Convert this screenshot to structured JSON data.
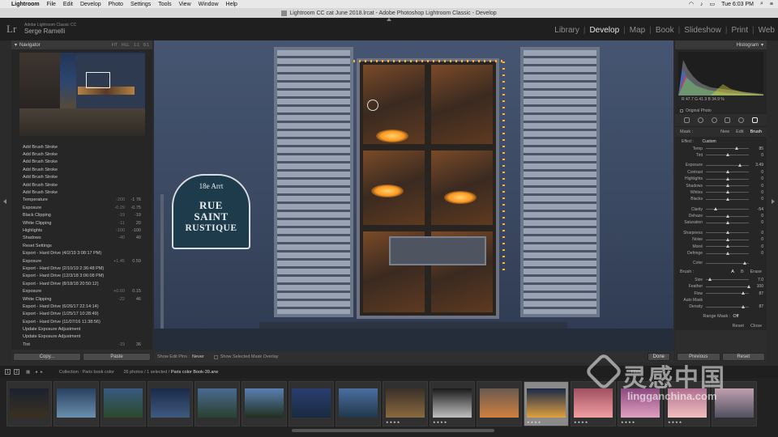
{
  "menubar": {
    "items": [
      "Lightroom",
      "File",
      "Edit",
      "Develop",
      "Photo",
      "Settings",
      "Tools",
      "View",
      "Window",
      "Help"
    ],
    "clock": "Tue 6:03 PM"
  },
  "titlebar": {
    "title": "Lightroom CC cat June 2018.lrcat - Adobe Photoshop Lightroom Classic - Develop"
  },
  "identity": {
    "logo": "Lr",
    "product": "Adobe Lightroom Classic CC",
    "user": "Serge Ramelli"
  },
  "modules": [
    "Library",
    "Develop",
    "Map",
    "Book",
    "Slideshow",
    "Print",
    "Web"
  ],
  "navigator": {
    "title": "Navigator",
    "zoom": [
      "FIT",
      "FILL",
      "1:1",
      "8:1"
    ]
  },
  "history": [
    {
      "label": "Add Brush Stroke",
      "from": "",
      "to": ""
    },
    {
      "label": "Add Brush Stroke",
      "from": "",
      "to": ""
    },
    {
      "label": "Add Brush Stroke",
      "from": "",
      "to": ""
    },
    {
      "label": "Add Brush Stroke",
      "from": "",
      "to": ""
    },
    {
      "label": "Add Brush Stroke",
      "from": "",
      "to": ""
    },
    {
      "label": "Add Brush Stroke",
      "from": "",
      "to": ""
    },
    {
      "label": "Add Brush Stroke",
      "from": "",
      "to": ""
    },
    {
      "label": "Temperature",
      "from": "-200",
      "to": "-1 76"
    },
    {
      "label": "Exposure",
      "from": "-0.29",
      "to": "-0.75"
    },
    {
      "label": "Black Clipping",
      "from": "-19",
      "to": "-19"
    },
    {
      "label": "White Clipping",
      "from": "-11",
      "to": "20"
    },
    {
      "label": "Highlights",
      "from": "-100",
      "to": "-100"
    },
    {
      "label": "Shadows",
      "from": "-40",
      "to": "40"
    },
    {
      "label": "Reset Settings",
      "from": "",
      "to": ""
    },
    {
      "label": "Export - Hard Drive (4/2/19 3:08:17 PM)",
      "from": "",
      "to": ""
    },
    {
      "label": "Exposure",
      "from": "+1.45",
      "to": "0.59"
    },
    {
      "label": "Export - Hard Drive (2/10/19 2:36:48 PM)",
      "from": "",
      "to": ""
    },
    {
      "label": "Export - Hard Drive (12/3/18 3:06:08 PM)",
      "from": "",
      "to": ""
    },
    {
      "label": "Export - Hard Drive (8/18/18 20:50:12)",
      "from": "",
      "to": ""
    },
    {
      "label": "Exposure",
      "from": "+0.60",
      "to": "0.15"
    },
    {
      "label": "White Clipping",
      "from": "-22",
      "to": "46"
    },
    {
      "label": "Export - Hard Drive (6/26/17 22:14:14)",
      "from": "",
      "to": ""
    },
    {
      "label": "Export - Hard Drive (1/25/17 10:28:49)",
      "from": "",
      "to": ""
    },
    {
      "label": "Export - Hard Drive (11/07/16 11:38:56)",
      "from": "",
      "to": ""
    },
    {
      "label": "Update Exposure Adjustment",
      "from": "",
      "to": ""
    },
    {
      "label": "Update Exposure Adjustment",
      "from": "",
      "to": ""
    },
    {
      "label": "Tint",
      "from": "-19",
      "to": "36"
    }
  ],
  "left_buttons": {
    "copy": "Copy...",
    "paste": "Paste"
  },
  "sign": {
    "arr": "18e Arrt",
    "line1": "RUE",
    "line2": "SAINT",
    "line3": "RUSTIQUE"
  },
  "toolbar": {
    "show_edit_pins_label": "Show Edit Pins :",
    "show_edit_pins_value": "Never",
    "overlay_label": "Show Selected Mask Overlay",
    "done": "Done"
  },
  "right_panel": {
    "histogram_title": "Histogram",
    "readout": "R 47.7  G 41.9  B 34.9 %",
    "original_photo": "Original Photo",
    "mask_label": "Mask :",
    "mask_modes": [
      "New",
      "Edit",
      "Brush"
    ],
    "effect_label": "Effect :",
    "effect_value": "Custom",
    "sliders": [
      {
        "label": "Temp",
        "pos": 0.72,
        "value": "85"
      },
      {
        "label": "Tint",
        "pos": 0.5,
        "value": "0"
      },
      {
        "gap": true
      },
      {
        "label": "Exposure",
        "pos": 0.8,
        "value": "3.49"
      },
      {
        "label": "Contrast",
        "pos": 0.5,
        "value": "0"
      },
      {
        "label": "Highlights",
        "pos": 0.5,
        "value": "0"
      },
      {
        "label": "Shadows",
        "pos": 0.5,
        "value": "0"
      },
      {
        "label": "Whites",
        "pos": 0.5,
        "value": "0"
      },
      {
        "label": "Blacks",
        "pos": 0.5,
        "value": "0"
      },
      {
        "gap": true
      },
      {
        "label": "Clarity",
        "pos": 0.22,
        "value": "-54"
      },
      {
        "label": "Dehaze",
        "pos": 0.5,
        "value": "0"
      },
      {
        "label": "Saturation",
        "pos": 0.5,
        "value": "0"
      },
      {
        "gap": true
      },
      {
        "label": "Sharpness",
        "pos": 0.5,
        "value": "0"
      },
      {
        "label": "Noise",
        "pos": 0.5,
        "value": "0"
      },
      {
        "label": "Moiré",
        "pos": 0.5,
        "value": "0"
      },
      {
        "label": "Defringe",
        "pos": 0.5,
        "value": "0"
      },
      {
        "gap": true
      },
      {
        "label": "Color",
        "pos": 0.9,
        "value": ""
      }
    ],
    "brush_label": "Brush :",
    "brush_modes": [
      "A",
      "B",
      "Erase"
    ],
    "brush_sliders": [
      {
        "label": "Size",
        "pos": 0.1,
        "value": "7.0"
      },
      {
        "label": "Feather",
        "pos": 1.0,
        "value": "100"
      },
      {
        "label": "Flow",
        "pos": 0.87,
        "value": "87"
      },
      {
        "label": "Auto Mask",
        "pos": -1,
        "value": ""
      },
      {
        "label": "Density",
        "pos": 0.87,
        "value": "87"
      }
    ],
    "range_mask_label": "Range Mask :",
    "range_mask_value": "Off",
    "reset": "Reset",
    "close": "Close",
    "previous": "Previous",
    "reset_button": "Reset"
  },
  "film_bar": {
    "view1": "1",
    "view2": "2",
    "collection": "Collection : Paris book color",
    "count": "26 photos / 1 selected /",
    "filename": "Paris color Book-39.arw",
    "filter_label": "Filter :"
  },
  "thumbs": [
    {
      "colors": [
        "#1c2230",
        "#3a3020"
      ],
      "stars": ""
    },
    {
      "colors": [
        "#2a4060",
        "#6a90b0"
      ],
      "stars": ""
    },
    {
      "colors": [
        "#3a5a80",
        "#2a4a2a"
      ],
      "stars": ""
    },
    {
      "colors": [
        "#1a2a48",
        "#405a80"
      ],
      "stars": ""
    },
    {
      "colors": [
        "#4a6a90",
        "#2a4030"
      ],
      "stars": ""
    },
    {
      "colors": [
        "#5a80b0",
        "#203020"
      ],
      "stars": ""
    },
    {
      "colors": [
        "#2a3e70",
        "#1a2a40"
      ],
      "stars": ""
    },
    {
      "colors": [
        "#4a6ea0",
        "#20384a"
      ],
      "stars": ""
    },
    {
      "colors": [
        "#3a3028",
        "#8a6a40"
      ],
      "stars": "★★★★"
    },
    {
      "colors": [
        "#1a1a1a",
        "#c0c0c0"
      ],
      "stars": "★★★★"
    },
    {
      "colors": [
        "#6a5a50",
        "#d08040"
      ],
      "stars": ""
    },
    {
      "colors": [
        "#1a2a48",
        "#e0a040"
      ],
      "stars": "★★★★"
    },
    {
      "colors": [
        "#a05060",
        "#f0a0a0"
      ],
      "stars": "★★★★"
    },
    {
      "colors": [
        "#8a4a80",
        "#e0a0c0"
      ],
      "stars": "★★★★"
    },
    {
      "colors": [
        "#b07090",
        "#f0c0c0"
      ],
      "stars": "★★★★"
    },
    {
      "colors": [
        "#c0a0b0",
        "#505060"
      ],
      "stars": ""
    }
  ],
  "watermark": {
    "cn": "灵感中国",
    "url": "lingganchina.com"
  }
}
